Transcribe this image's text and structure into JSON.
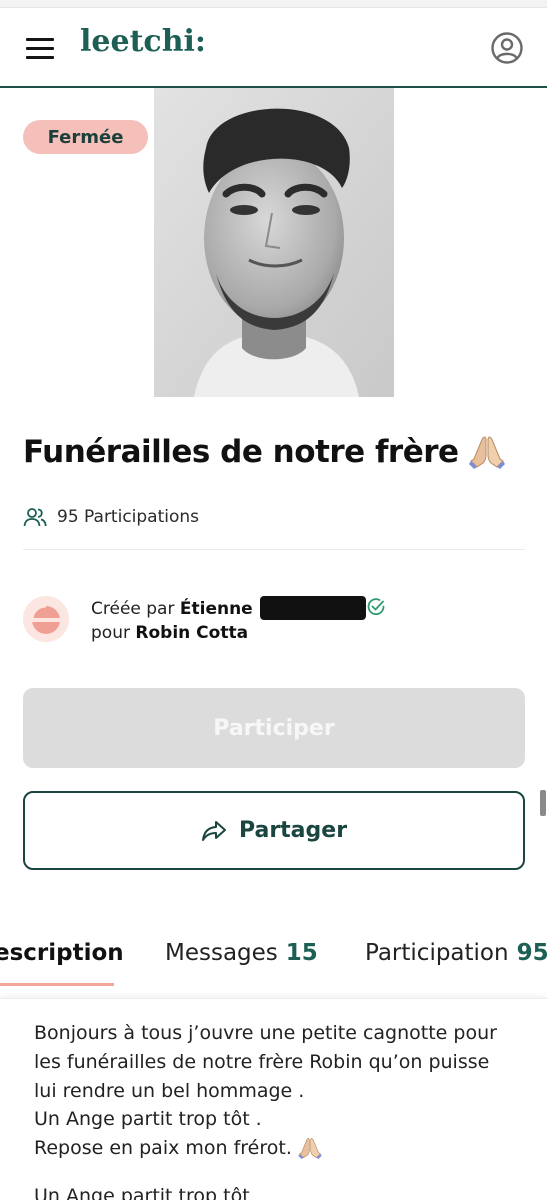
{
  "header": {
    "logo": "leetchi:",
    "menu_icon": "hamburger-menu-icon",
    "account_icon": "user-account-icon"
  },
  "status_badge": "Fermée",
  "campaign": {
    "title": "Funérailles de notre frère",
    "title_emoji": "folded-hands-emoji",
    "participations_count": "95",
    "participations_label": "Participations",
    "participations_text": "95 Participations"
  },
  "creator": {
    "created_by_label": "Créée par",
    "creator_first_name": "Étienne",
    "for_label": "pour",
    "beneficiary": "Robin Cotta",
    "verified_icon": "verified-check-icon"
  },
  "actions": {
    "participate_label": "Participer",
    "share_label": "Partager",
    "share_icon": "share-arrow-icon"
  },
  "tabs": [
    {
      "label": "escription",
      "count": ""
    },
    {
      "label": "Messages",
      "count": "15"
    },
    {
      "label": "Participation",
      "count": "95"
    }
  ],
  "description": {
    "lines": [
      "Bonjours à tous j’ouvre une petite cagnotte pour",
      "les funérailles de notre frère Robin qu’on puisse",
      "lui rendre un bel hommage .",
      "Un Ange partit trop tôt .",
      "Repose en paix mon frérot."
    ],
    "cut_line": "Un Ange partit trop tôt"
  },
  "colors": {
    "brand": "#1e5f55",
    "badge_bg": "#f4c0b9",
    "disabled_button": "#dcdcdc",
    "tab_underline": "#f1a79c"
  }
}
